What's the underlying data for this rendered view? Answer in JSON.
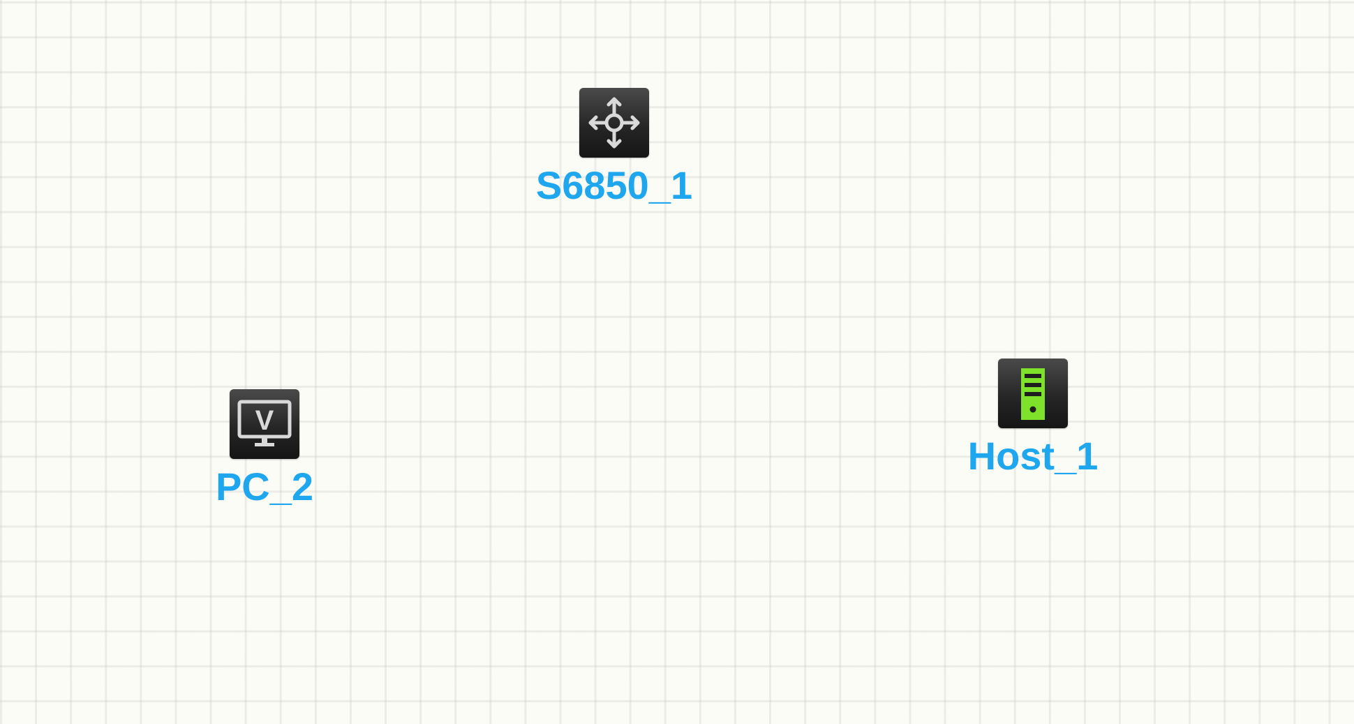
{
  "canvas": {
    "background": "#fcfcf7",
    "grid_color": "#e6e6e6"
  },
  "devices": [
    {
      "label": "S6850_1",
      "icon": "switch-arrows-icon",
      "label_color": "#1ea6ee"
    },
    {
      "label": "PC_2",
      "icon": "monitor-v-icon",
      "label_color": "#1ea6ee"
    },
    {
      "label": "Host_1",
      "icon": "server-tower-icon",
      "icon_color": "#7ee22a",
      "label_color": "#1ea6ee"
    }
  ]
}
